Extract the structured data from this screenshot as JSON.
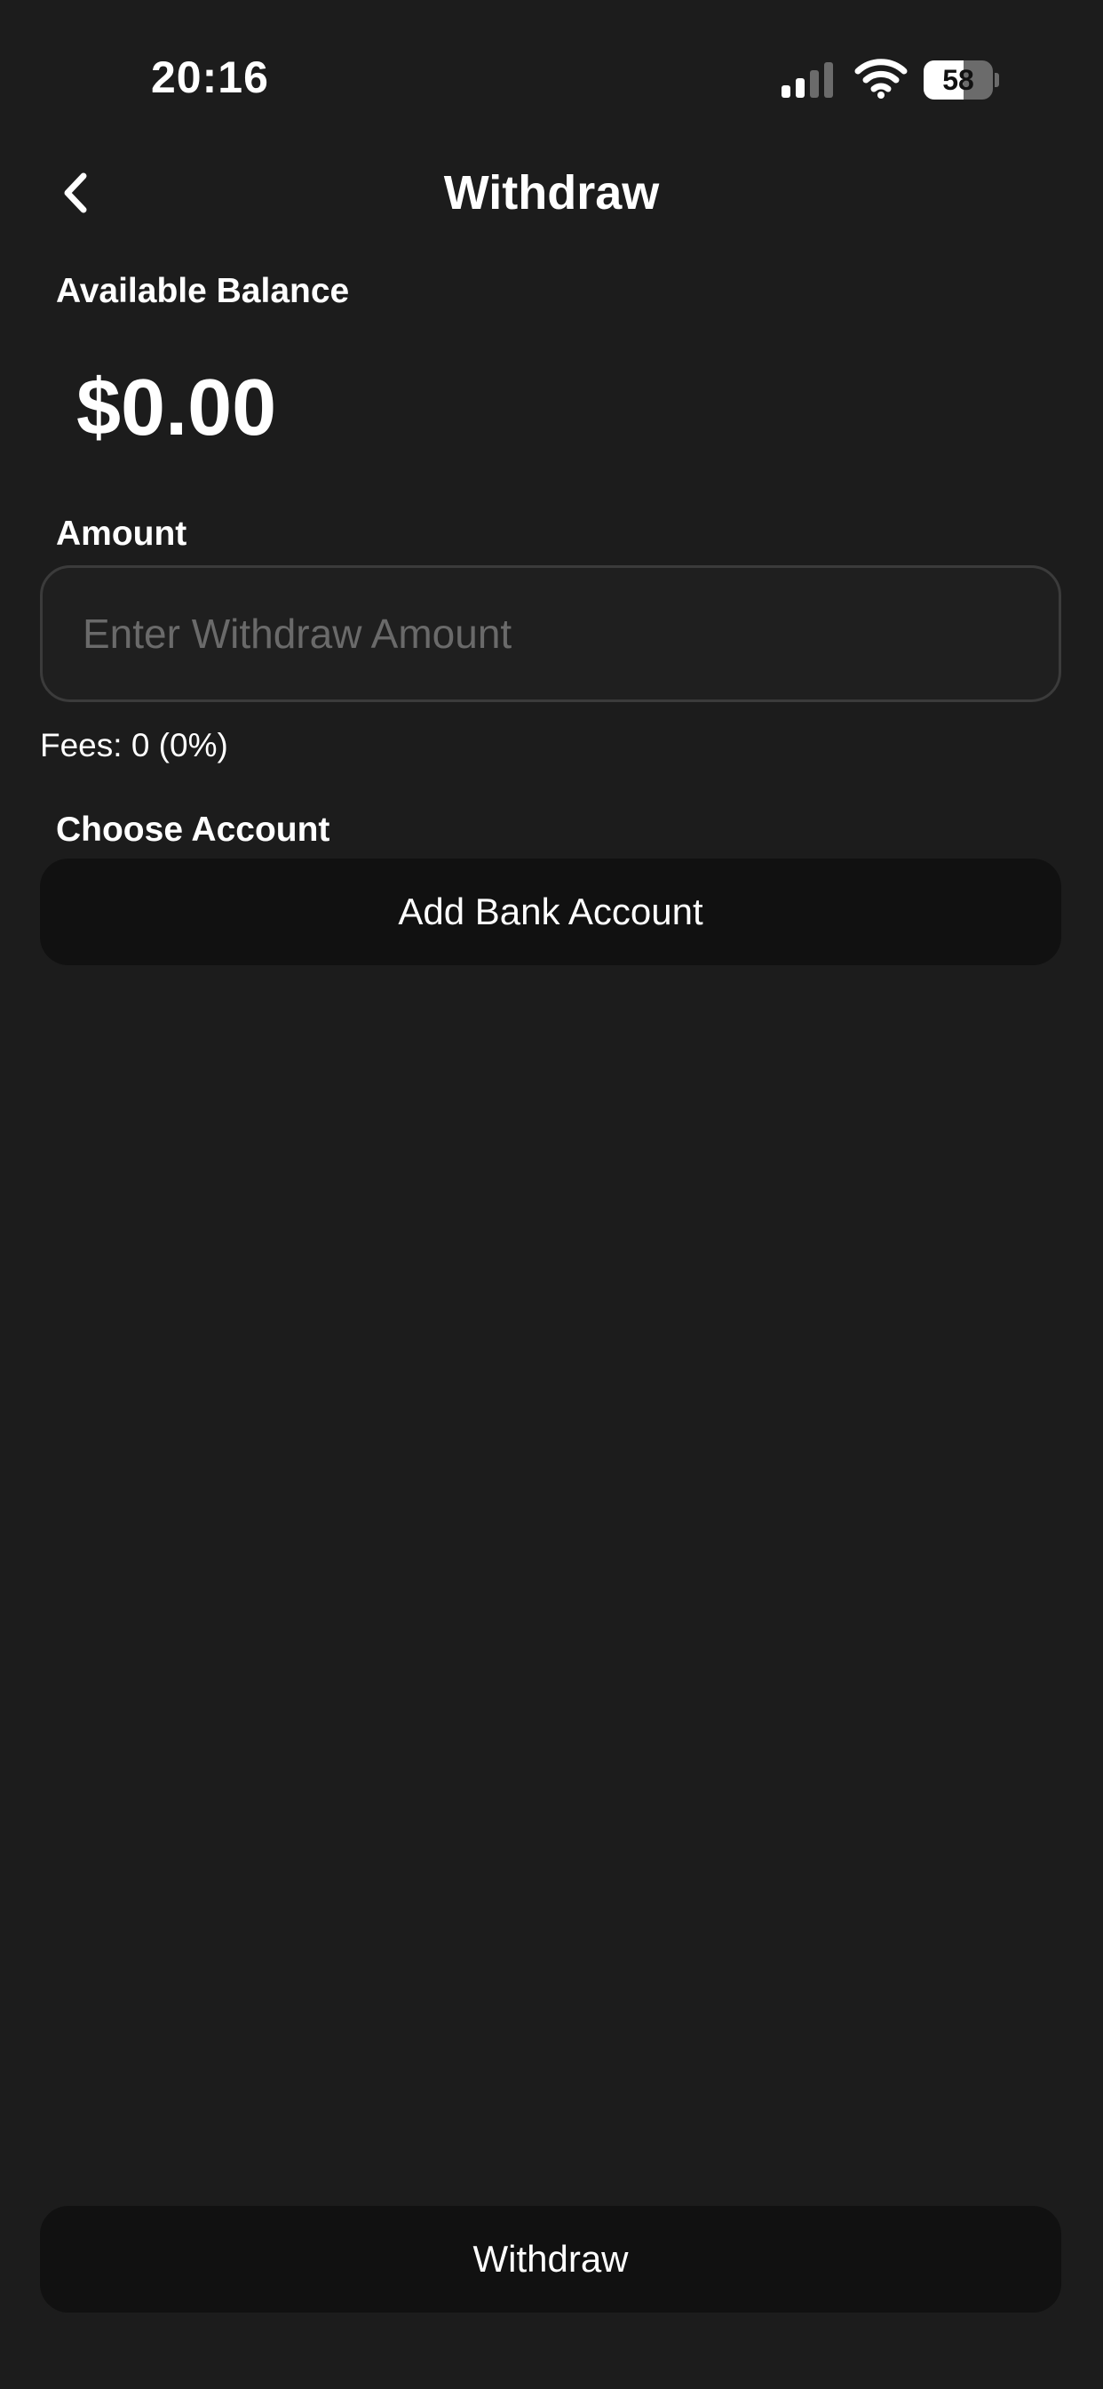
{
  "status_bar": {
    "time": "20:16",
    "battery_level": "58",
    "battery_fraction": 0.58,
    "signal_icon": "signal-bars-icon",
    "wifi_icon": "wifi-icon",
    "battery_icon": "battery-icon"
  },
  "header": {
    "back_icon": "chevron-left-icon",
    "title": "Withdraw"
  },
  "balance": {
    "label": "Available Balance",
    "value": "$0.00"
  },
  "amount": {
    "label": "Amount",
    "placeholder": "Enter Withdraw Amount",
    "value": ""
  },
  "fees": {
    "text": "Fees: 0 (0%)"
  },
  "account": {
    "label": "Choose Account",
    "add_button_label": "Add Bank Account"
  },
  "footer": {
    "withdraw_label": "Withdraw"
  },
  "colors": {
    "background": "#1c1c1c",
    "button_background": "#111111",
    "input_border": "#3b3b3b",
    "placeholder_text": "#6a6a6a",
    "text": "#ffffff"
  }
}
